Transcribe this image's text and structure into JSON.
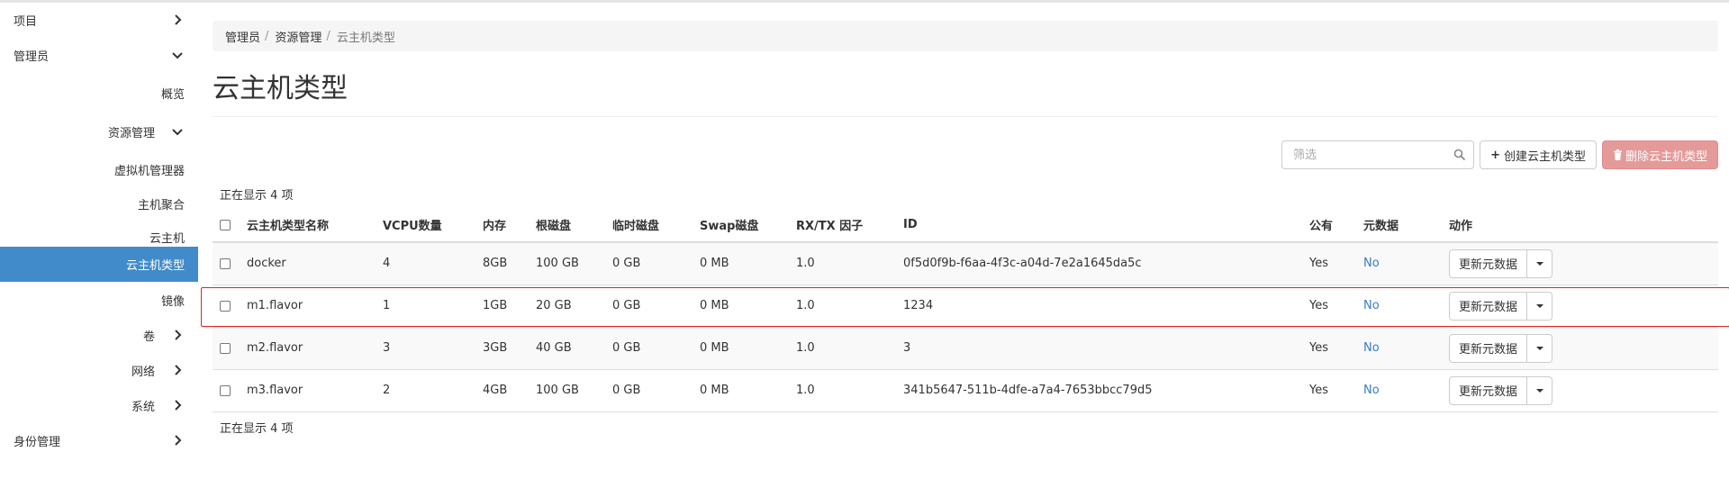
{
  "sidebar": {
    "items": [
      {
        "label": "项目",
        "chevron": "right"
      },
      {
        "label": "管理员",
        "chevron": "down"
      },
      {
        "label": "概览"
      },
      {
        "label": "资源管理",
        "chevron": "down"
      },
      {
        "label": "虚拟机管理器"
      },
      {
        "label": "主机聚合"
      },
      {
        "label": "云主机"
      },
      {
        "label": "云主机类型",
        "active": true
      },
      {
        "label": "镜像"
      },
      {
        "label": "卷",
        "chevron": "right"
      },
      {
        "label": "网络",
        "chevron": "right"
      },
      {
        "label": "系统",
        "chevron": "right"
      },
      {
        "label": "身份管理",
        "chevron": "right"
      }
    ]
  },
  "breadcrumb": [
    "管理员",
    "资源管理",
    "云主机类型"
  ],
  "page_title": "云主机类型",
  "toolbar": {
    "filter_placeholder": "筛选",
    "create_label": "创建云主机类型",
    "delete_label": "删除云主机类型"
  },
  "count_text": "正在显示 4 项",
  "table": {
    "columns": [
      "云主机类型名称",
      "VCPU数量",
      "内存",
      "根磁盘",
      "临时磁盘",
      "Swap磁盘",
      "RX/TX 因子",
      "ID",
      "公有",
      "元数据",
      "动作"
    ],
    "rows": [
      [
        "docker",
        "4",
        "8GB",
        "100 GB",
        "0 GB",
        "0 MB",
        "1.0",
        "0f5d0f9b-f6aa-4f3c-a04d-7e2a1645da5c",
        "Yes",
        "No"
      ],
      [
        "m1.flavor",
        "1",
        "1GB",
        "20 GB",
        "0 GB",
        "0 MB",
        "1.0",
        "1234",
        "Yes",
        "No"
      ],
      [
        "m2.flavor",
        "3",
        "3GB",
        "40 GB",
        "0 GB",
        "0 MB",
        "1.0",
        "3",
        "Yes",
        "No"
      ],
      [
        "m3.flavor",
        "2",
        "4GB",
        "100 GB",
        "0 GB",
        "0 MB",
        "1.0",
        "341b5647-511b-4dfe-a7a4-7653bbcc79d5",
        "Yes",
        "No"
      ]
    ],
    "row_action_label": "更新元数据"
  },
  "colors": {
    "active_nav": "#428bca",
    "danger_button": "#e59a9a",
    "link": "#3a7cc4",
    "highlight": "#e02424"
  }
}
